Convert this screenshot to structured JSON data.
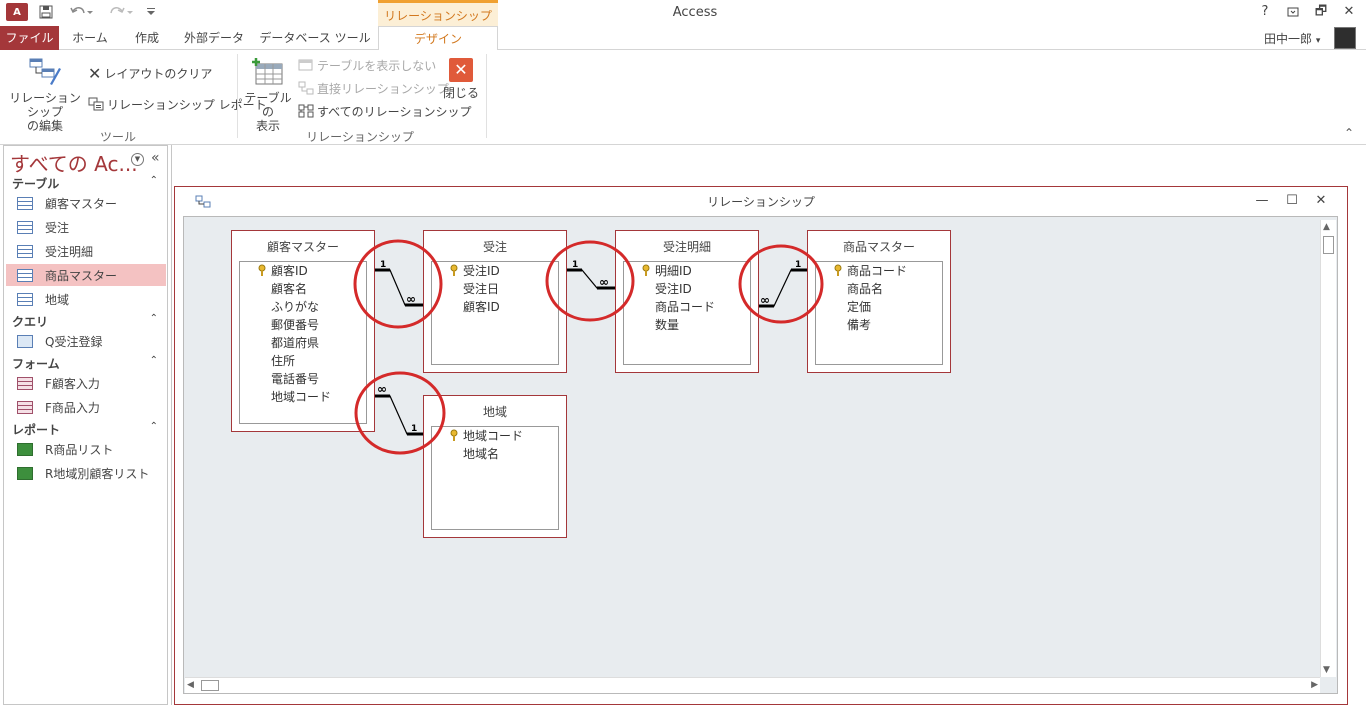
{
  "titlebar": {
    "app_logo": "A",
    "title": "Access",
    "context_group": "リレーションシップ ツール",
    "help": "?",
    "minimize": "—",
    "restore": "🗗",
    "close": "✕",
    "qat_icons": [
      "save-icon",
      "undo-icon",
      "redo-icon",
      "customize-qat-icon"
    ]
  },
  "tabs": {
    "file": "ファイル",
    "home": "ホーム",
    "create": "作成",
    "external": "外部データ",
    "dbtools": "データベース ツール",
    "design": "デザイン"
  },
  "user": {
    "name": "田中一郎",
    "dropdown": "▾"
  },
  "ribbon": {
    "tools": {
      "edit_line1": "リレーションシップ",
      "edit_line2": "の編集",
      "clear_layout": "レイアウトのクリア",
      "rel_report": "リレーションシップ レポート",
      "group_label": "ツール"
    },
    "relationships": {
      "show_table_line1": "テーブルの",
      "show_table_line2": "表示",
      "hide_table": "テーブルを表示しない",
      "direct_rel": "直接リレーションシップ",
      "all_rel": "すべてのリレーションシップ",
      "close": "閉じる",
      "group_label": "リレーションシップ"
    },
    "collapse_glyph": "⌃"
  },
  "nav": {
    "title": "すべての Ac...",
    "collapse_glyph": "«",
    "groups": [
      {
        "label": "テーブル",
        "chevron": "⌃"
      },
      {
        "label": "クエリ",
        "chevron": "⌃"
      },
      {
        "label": "フォーム",
        "chevron": "⌃"
      },
      {
        "label": "レポート",
        "chevron": "⌃"
      }
    ],
    "tables": [
      "顧客マスター",
      "受注",
      "受注明細",
      "商品マスター",
      "地域"
    ],
    "queries": [
      "Q受注登録"
    ],
    "forms": [
      "F顧客入力",
      "F商品入力"
    ],
    "reports": [
      "R商品リスト",
      "R地域別顧客リスト"
    ],
    "selected": "商品マスター"
  },
  "relwin": {
    "title": "リレーションシップ",
    "minimize": "—",
    "maximize": "☐",
    "close": "✕"
  },
  "tables": [
    {
      "name": "顧客マスター",
      "fields": [
        "顧客ID",
        "顧客名",
        "ふりがな",
        "郵便番号",
        "都道府県",
        "住所",
        "電話番号",
        "地域コード"
      ],
      "key": "顧客ID"
    },
    {
      "name": "受注",
      "fields": [
        "受注ID",
        "受注日",
        "顧客ID"
      ],
      "key": "受注ID"
    },
    {
      "name": "受注明細",
      "fields": [
        "明細ID",
        "受注ID",
        "商品コード",
        "数量"
      ],
      "key": "明細ID"
    },
    {
      "name": "商品マスター",
      "fields": [
        "商品コード",
        "商品名",
        "定価",
        "備考"
      ],
      "key": "商品コード"
    },
    {
      "name": "地域",
      "fields": [
        "地域コード",
        "地域名"
      ],
      "key": "地域コード"
    }
  ],
  "relationships": [
    {
      "one": "1",
      "many": "∞"
    },
    {
      "one": "1",
      "many": "∞"
    },
    {
      "one": "1",
      "many": "∞"
    },
    {
      "one": "1",
      "many": "∞"
    }
  ],
  "colors": {
    "accent": "#a4373a",
    "context": "#d2781e",
    "annotation": "#d42a2a"
  }
}
